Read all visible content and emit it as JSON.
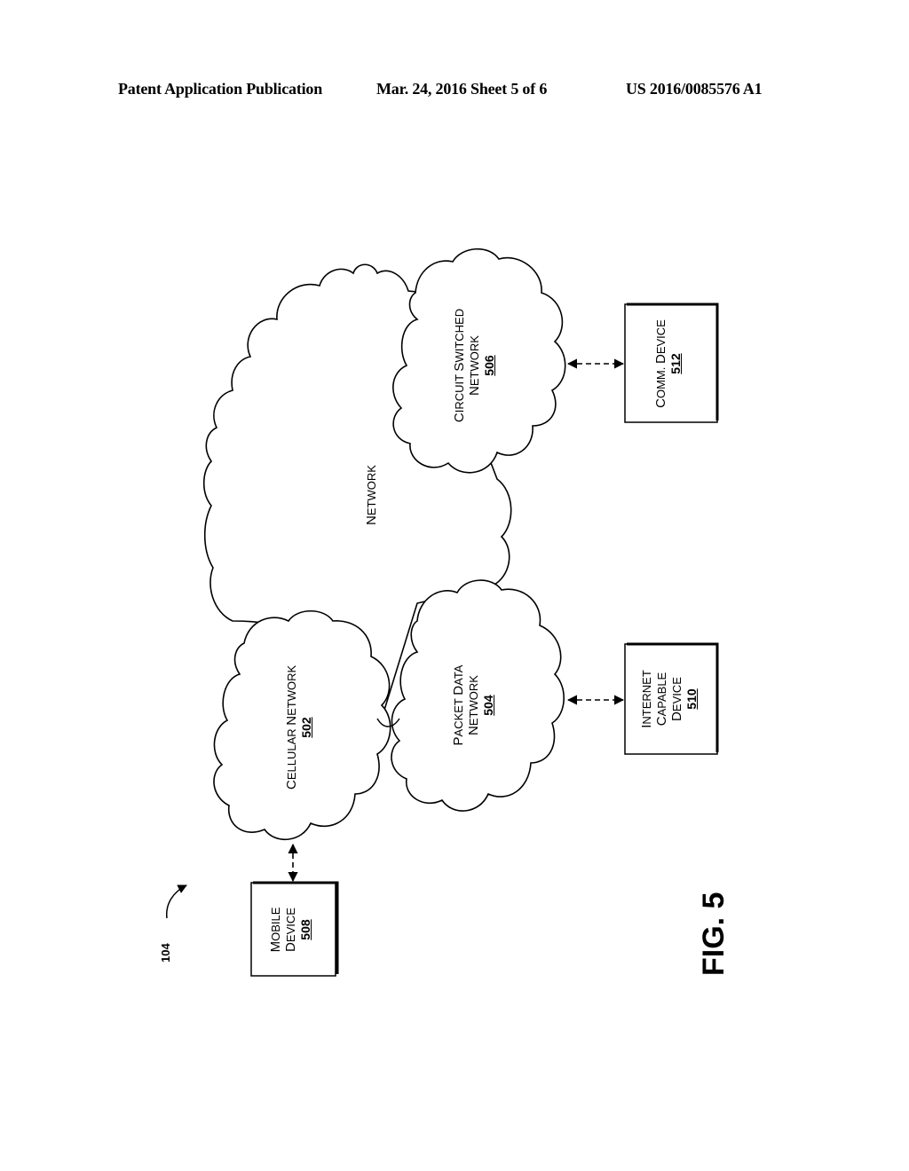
{
  "header": {
    "publication": "Patent Application Publication",
    "date_sheet": "Mar. 24, 2016  Sheet 5 of 6",
    "number": "US 2016/0085576 A1"
  },
  "figure": {
    "label": "FIG. 5",
    "reference": "104"
  },
  "network": {
    "label_first": "N",
    "label_rest": "ETWORK"
  },
  "clouds": {
    "cellular": {
      "w1_first": "C",
      "w1_rest": "ELLULAR",
      "w2_first": "N",
      "w2_rest": "ETWORK",
      "number": "502"
    },
    "packet": {
      "w1_first": "P",
      "w1_rest": "ACKET",
      "w2_first": "D",
      "w2_rest": "ATA",
      "line2_first": "N",
      "line2_rest": "ETWORK",
      "number": "504"
    },
    "circuit": {
      "w1_first": "C",
      "w1_rest": "IRCUIT",
      "w2_first": "S",
      "w2_rest": "WITCHED",
      "line2_first": "N",
      "line2_rest": "ETWORK",
      "number": "506"
    }
  },
  "devices": {
    "mobile": {
      "l1_first": "M",
      "l1_rest": "OBILE",
      "l2_first": "D",
      "l2_rest": "EVICE",
      "number": "508"
    },
    "internet": {
      "l1_first": "I",
      "l1_rest": "NTERNET",
      "l2_first": "C",
      "l2_rest": "APABLE",
      "l3_first": "D",
      "l3_rest": "EVICE",
      "number": "510"
    },
    "comm": {
      "w1_first": "C",
      "w1_rest": "OMM.",
      "w2_first": "D",
      "w2_rest": "EVICE",
      "number": "512"
    }
  }
}
